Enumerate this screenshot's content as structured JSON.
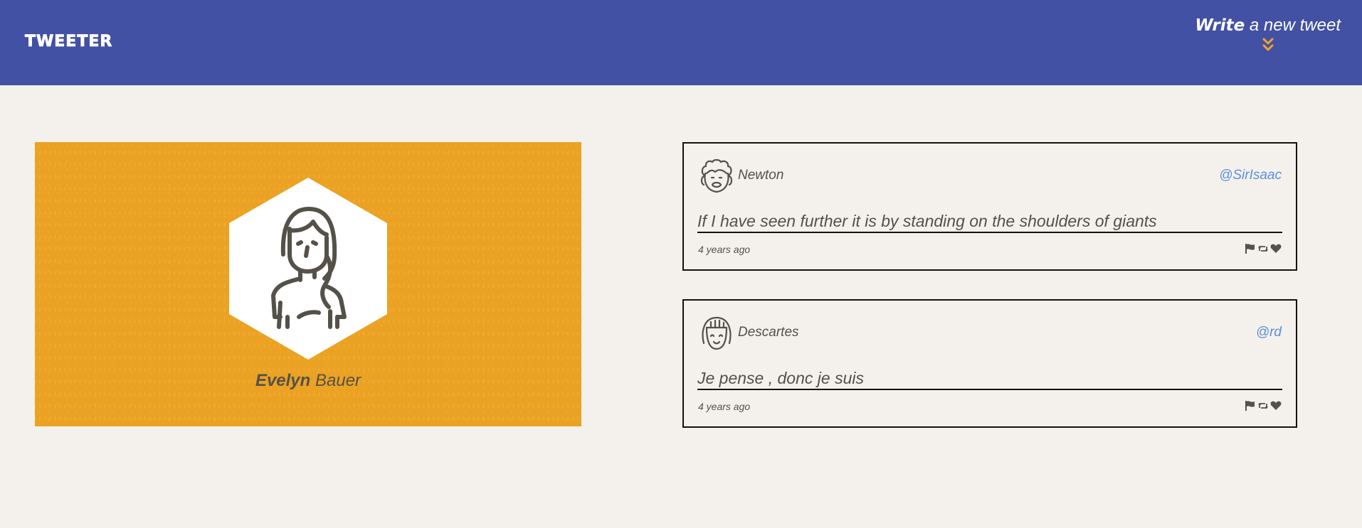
{
  "header": {
    "logo": "TWEETER",
    "compose_strong": "Write",
    "compose_rest": " a new tweet",
    "compose_icon": "double-chevron-down-icon",
    "background_color": "#4251a3",
    "accent_color": "#f0a22b"
  },
  "profile": {
    "first_name": "Evelyn",
    "last_name": " Bauer",
    "avatar_icon": "woman-avatar-icon",
    "card_color": "#eba222"
  },
  "tweets": [
    {
      "name": "Newton",
      "handle": "@SirIsaac",
      "text": "If I have seen further it is by standing on the shoulders of giants",
      "time": "4 years ago",
      "avatar_icon": "curly-hair-avatar-icon",
      "actions": [
        "flag-icon",
        "retweet-icon",
        "heart-icon"
      ]
    },
    {
      "name": "Descartes",
      "handle": "@rd",
      "text": "Je pense , donc je suis",
      "time": "4 years ago",
      "avatar_icon": "bangs-avatar-icon",
      "actions": [
        "flag-icon",
        "retweet-icon",
        "heart-icon"
      ]
    }
  ],
  "colors": {
    "page_background": "#f4f1ec",
    "text": "#545149",
    "handle": "#5b8fdc",
    "border": "#111111"
  }
}
